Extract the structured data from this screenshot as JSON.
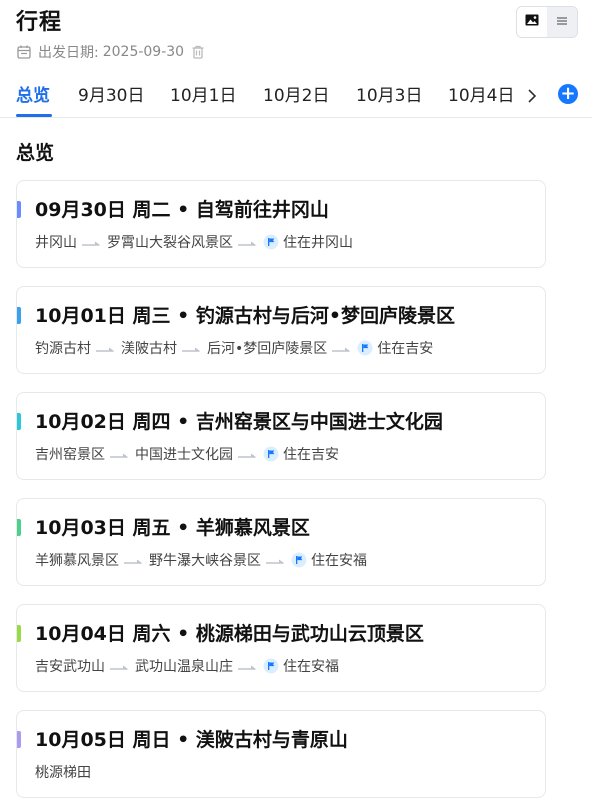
{
  "header": {
    "title": "行程",
    "date_label": "出发日期:",
    "date_value": "2025-09-30"
  },
  "view_toggle": {
    "active": "image-view",
    "inactive": "list-view"
  },
  "tabs": [
    {
      "label": "总览",
      "active": true
    },
    {
      "label": "9月30日"
    },
    {
      "label": "10月1日"
    },
    {
      "label": "10月2日"
    },
    {
      "label": "10月3日"
    },
    {
      "label": "10月4日"
    }
  ],
  "add_label": "+",
  "section_title": "总览",
  "days": [
    {
      "title": "09月30日 周二 • 自驾前往井冈山",
      "color": "#6b8cff",
      "stops": [
        "井冈山",
        "罗霄山大裂谷风景区"
      ],
      "stay": "住在井冈山"
    },
    {
      "title": "10月01日 周三 • 钓源古村与后河•梦回庐陵景区",
      "color": "#3aa0f0",
      "stops": [
        "钓源古村",
        "渼陂古村",
        "后河•梦回庐陵景区"
      ],
      "stay": "住在吉安"
    },
    {
      "title": "10月02日 周四 • 吉州窑景区与中国进士文化园",
      "color": "#2cc8d8",
      "stops": [
        "吉州窑景区",
        "中国进士文化园"
      ],
      "stay": "住在吉安"
    },
    {
      "title": "10月03日 周五 • 羊狮慕风景区",
      "color": "#4cd08a",
      "stops": [
        "羊狮慕风景区",
        "野牛瀑大峡谷景区"
      ],
      "stay": "住在安福"
    },
    {
      "title": "10月04日 周六 • 桃源梯田与武功山云顶景区",
      "color": "#9ad94a",
      "stops": [
        "吉安武功山",
        "武功山温泉山庄"
      ],
      "stay": "住在安福"
    },
    {
      "title": "10月05日 周日 • 渼陂古村与青原山",
      "color": "#a99cf0",
      "stops": [
        "桃源梯田"
      ],
      "stay": ""
    }
  ]
}
